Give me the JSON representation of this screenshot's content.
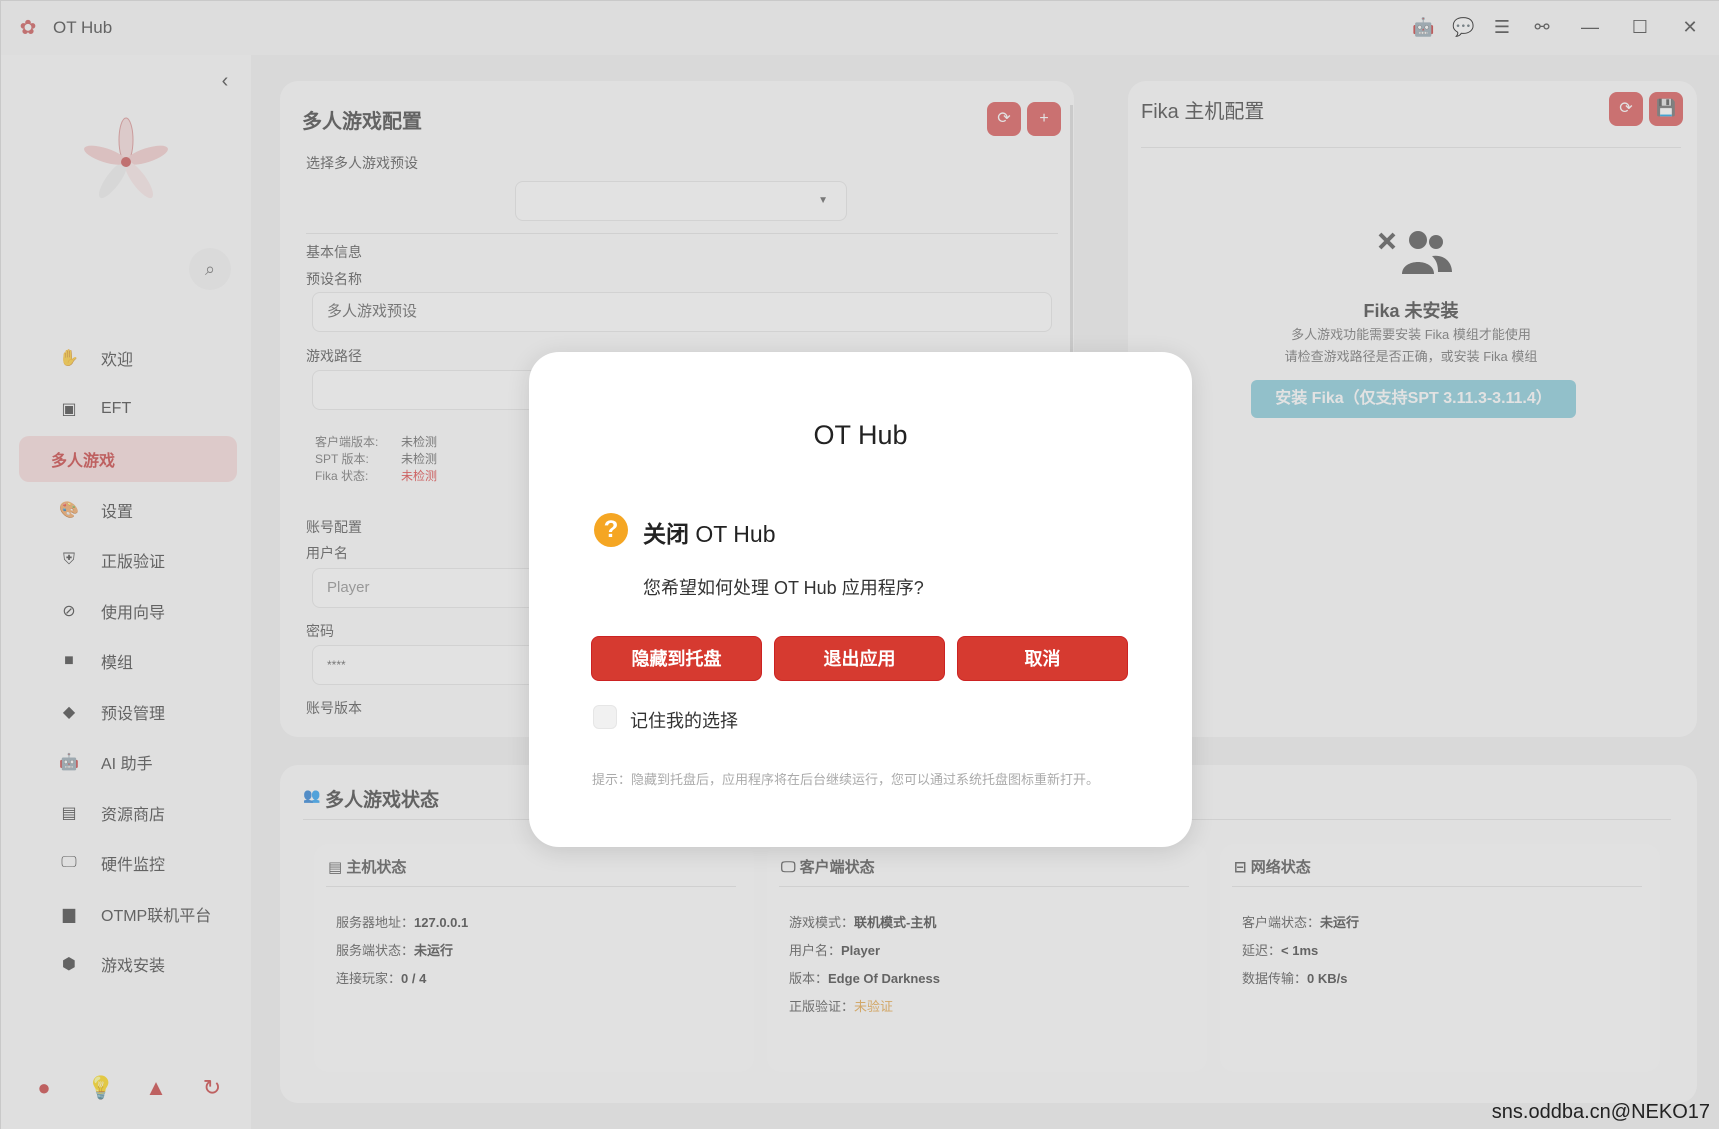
{
  "app": {
    "title": "OT Hub"
  },
  "titlebar": {
    "icons": [
      "robot-icon",
      "chat-icon",
      "list-icon",
      "network-icon"
    ],
    "controls": [
      "minimize-icon",
      "maximize-icon",
      "close-icon"
    ]
  },
  "sidebar": {
    "items": [
      {
        "label": "欢迎",
        "icon": "hand-icon"
      },
      {
        "label": "EFT",
        "icon": "eft-icon"
      },
      {
        "label": "多人游戏",
        "icon": ""
      },
      {
        "label": "设置",
        "icon": "palette-icon"
      },
      {
        "label": "正版验证",
        "icon": "shield-icon"
      },
      {
        "label": "使用向导",
        "icon": "compass-icon"
      },
      {
        "label": "模组",
        "icon": "module-icon"
      },
      {
        "label": "预设管理",
        "icon": "cards-icon"
      },
      {
        "label": "AI 助手",
        "icon": "robot-icon"
      },
      {
        "label": "资源商店",
        "icon": "store-icon"
      },
      {
        "label": "硬件监控",
        "icon": "monitor-icon"
      },
      {
        "label": "OTMP联机平台",
        "icon": "computer-icon"
      },
      {
        "label": "游戏安装",
        "icon": "install-icon"
      }
    ],
    "active_index": 2,
    "bottom_icons": [
      "github-icon",
      "bulb-icon",
      "qq-icon",
      "refresh-icon"
    ]
  },
  "config": {
    "title": "多人游戏配置",
    "preset_label": "选择多人游戏预设",
    "basic_info": "基本信息",
    "preset_name_label": "预设名称",
    "preset_name_value": "多人游戏预设",
    "game_path_label": "游戏路径",
    "client_version_label": "客户端版本:",
    "client_version_value": "未检测",
    "spt_version_label": "SPT 版本:",
    "spt_version_value": "未检测",
    "fika_status_label": "Fika 状态:",
    "fika_status_value": "未检测",
    "account_config": "账号配置",
    "username_label": "用户名",
    "username_placeholder": "Player",
    "password_label": "密码",
    "password_value": "****",
    "account_version_label": "账号版本"
  },
  "fika": {
    "title": "Fika 主机配置",
    "not_installed": "Fika 未安装",
    "desc1": "多人游戏功能需要安装 Fika 模组才能使用",
    "desc2": "请检查游戏路径是否正确，或安装 Fika 模组",
    "install_button": "安装 Fika（仅支持SPT 3.11.3-3.11.4）"
  },
  "status": {
    "title": "多人游戏状态",
    "host": {
      "title": "主机状态",
      "lines": [
        {
          "k": "服务器地址：",
          "v": "127.0.0.1"
        },
        {
          "k": "服务端状态：",
          "v": "未运行"
        },
        {
          "k": "连接玩家：",
          "v": "0 / 4"
        }
      ]
    },
    "client": {
      "title": "客户端状态",
      "lines": [
        {
          "k": "游戏模式：",
          "v": "联机模式-主机"
        },
        {
          "k": "用户名：",
          "v": "Player"
        },
        {
          "k": "版本：",
          "v": "Edge Of Darkness"
        },
        {
          "k": "正版验证：",
          "v": "未验证"
        }
      ]
    },
    "network": {
      "title": "网络状态",
      "lines": [
        {
          "k": "客户端状态：",
          "v": "未运行"
        },
        {
          "k": "延迟：",
          "v": "< 1ms"
        },
        {
          "k": "数据传输：",
          "v": "0 KB/s"
        }
      ]
    }
  },
  "dialog": {
    "title": "OT Hub",
    "heading_bold": "关闭",
    "heading_rest": " OT Hub",
    "message": "您希望如何处理 OT Hub 应用程序?",
    "buttons": {
      "hide": "隐藏到托盘",
      "exit": "退出应用",
      "cancel": "取消"
    },
    "remember": "记住我的选择",
    "hint": "提示：隐藏到托盘后，应用程序将在后台继续运行，您可以通过系统托盘图标重新打开。"
  },
  "watermark": "sns.oddba.cn@NEKO17",
  "colors": {
    "accent": "#d63a30",
    "active_bg": "#f7d9d9",
    "install": "#7fc8d8",
    "warn": "#e6a23c"
  }
}
